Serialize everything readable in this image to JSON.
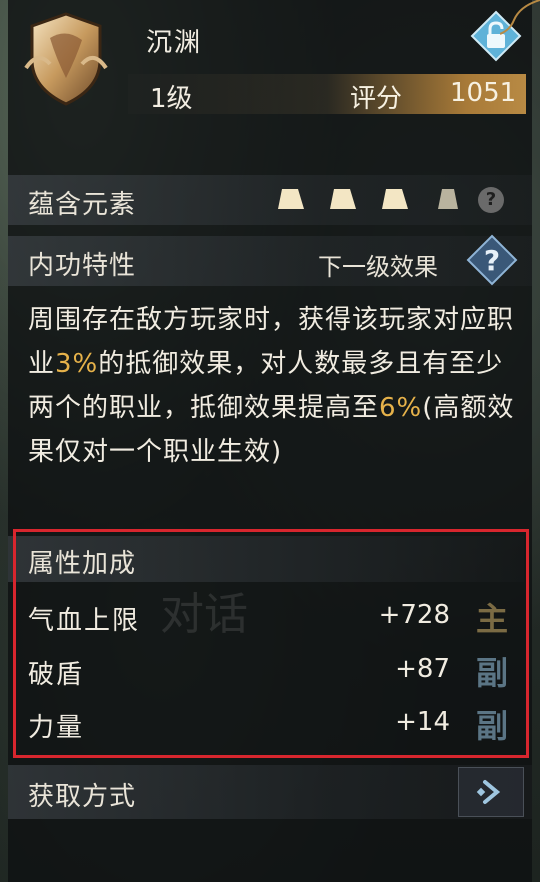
{
  "header": {
    "title": "沉渊",
    "level": "1级",
    "score_label": "评分",
    "score_value": "1051"
  },
  "elements_section": {
    "label": "蕴含元素",
    "help": "?"
  },
  "inner_skill": {
    "label": "内功特性",
    "next_effect": "下一级效果",
    "help": "?"
  },
  "description": {
    "part1": "周围存在敌方玩家时，获得该玩家对应职业",
    "value1": "3%",
    "part2": "的抵御效果，对人数最多且有至少两个的职业，抵御效果提高至",
    "value2": "6%",
    "part3": "(高额效果仅对一个职业生效)"
  },
  "attributes": {
    "label": "属性加成",
    "ghost_text": "对话",
    "rows": [
      {
        "name": "气血上限",
        "value": "+728",
        "tag": "主"
      },
      {
        "name": "破盾",
        "value": "+87",
        "tag": "副"
      },
      {
        "name": "力量",
        "value": "+14",
        "tag": "副"
      }
    ]
  },
  "acquire": {
    "label": "获取方式"
  },
  "colors": {
    "highlight": "#e6b24a",
    "red_frame": "#d8262e",
    "score_bar": "#b88a44",
    "tag_main": "#7b6b44",
    "tag_sub": "#5b7585"
  },
  "icons": [
    "emblem-icon",
    "lock-icon",
    "element-icon",
    "help-icon",
    "diamond-help-icon",
    "arrow-right-icon"
  ]
}
